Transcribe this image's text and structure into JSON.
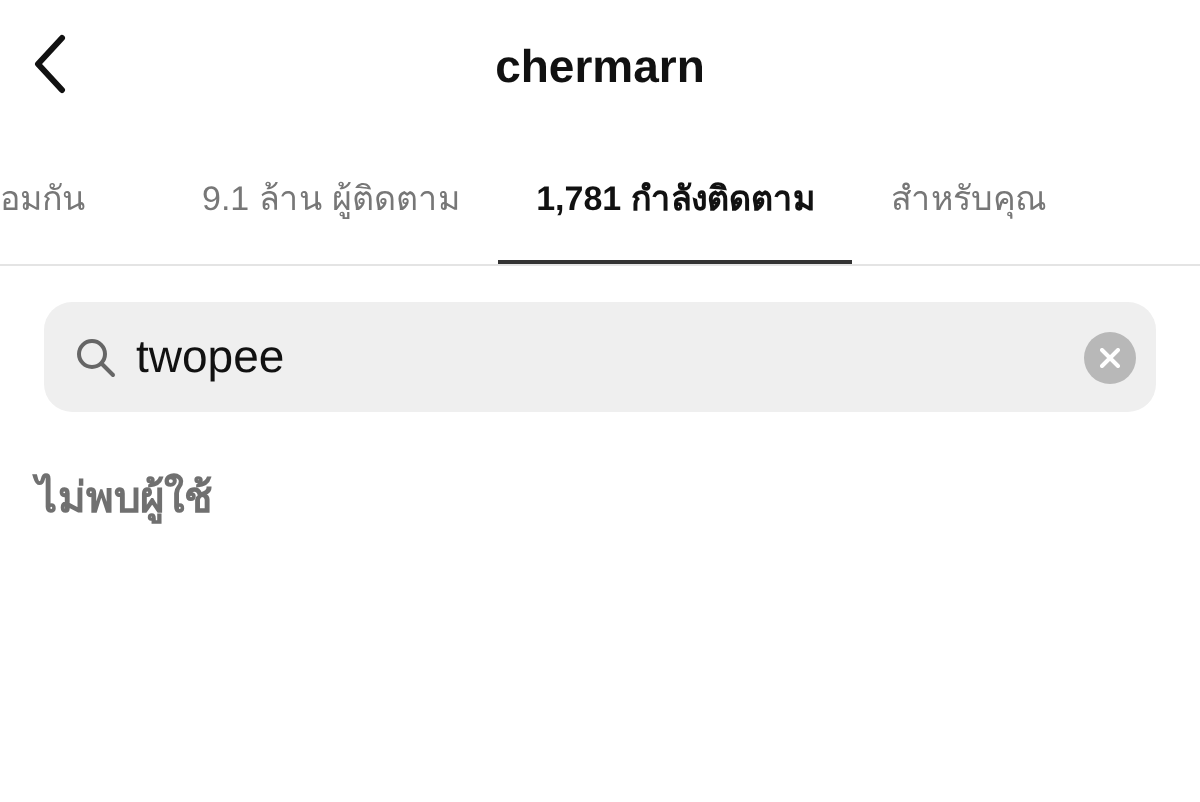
{
  "header": {
    "title": "chermarn"
  },
  "tabs": [
    {
      "label": "อมกัน",
      "selected": false
    },
    {
      "label": "9.1 ล้าน ผู้ติดตาม",
      "selected": false
    },
    {
      "label": "1,781 กำลังติดตาม",
      "selected": true
    },
    {
      "label": "สำหรับคุณ",
      "selected": false
    }
  ],
  "search": {
    "value": "twopee"
  },
  "message": "ไม่พบผู้ใช้"
}
